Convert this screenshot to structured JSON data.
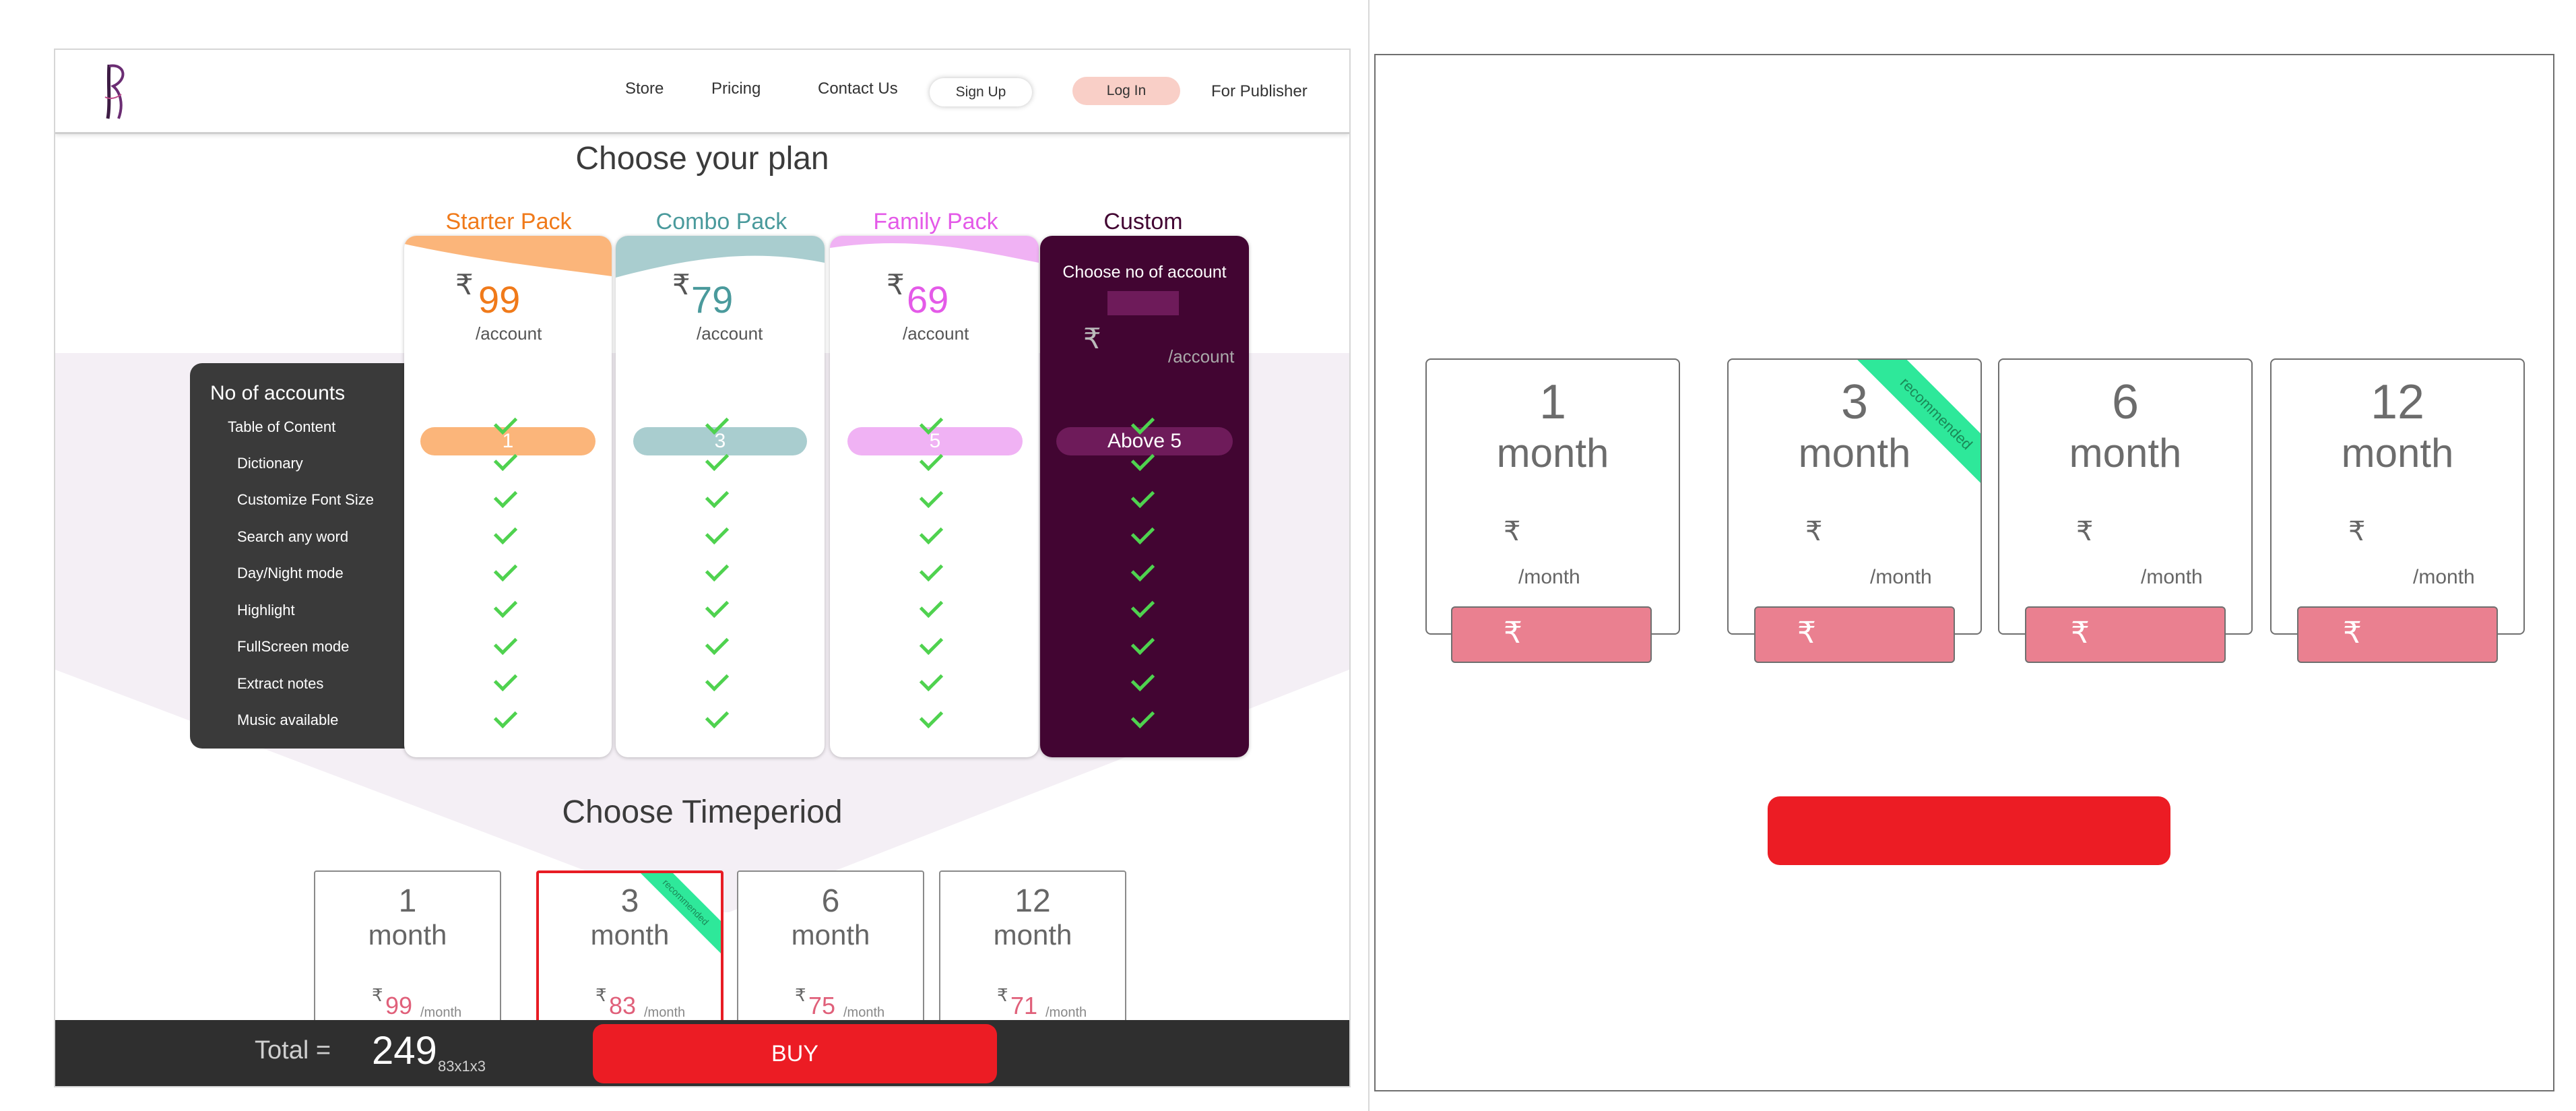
{
  "nav": {
    "logo_glyph": "R",
    "store": "Store",
    "pricing": "Pricing",
    "contact": "Contact Us",
    "signup": "Sign Up",
    "login": "Log In",
    "publisher": "For Publisher"
  },
  "plans": {
    "title": "Choose your plan",
    "currency": "₹",
    "per_account": "/account",
    "starter": {
      "name": "Starter Pack",
      "price": "99",
      "accounts": "1",
      "color": "#f07a1a",
      "tint": "#fbb57a"
    },
    "combo": {
      "name": "Combo Pack",
      "price": "79",
      "accounts": "3",
      "color": "#4a9a9c",
      "tint": "#a9cdcf"
    },
    "family": {
      "name": "Family Pack",
      "price": "69",
      "accounts": "5",
      "color": "#e45ae8",
      "tint": "#f0b2f4"
    },
    "custom": {
      "name": "Custom",
      "prompt": "Choose no of account",
      "accounts": "Above 5",
      "color": "#420532"
    }
  },
  "features": {
    "header": "No of accounts",
    "items": [
      "Table of Content",
      "Dictionary",
      "Customize Font Size",
      "Search any word",
      "Day/Night mode",
      "Highlight",
      "FullScreen mode",
      "Extract notes",
      "Music available"
    ]
  },
  "timeperiod": {
    "title": "Choose Timeperiod",
    "unit": "month",
    "per_month": "/month",
    "recommended": "recommended",
    "options": [
      {
        "months": "1",
        "price": "99"
      },
      {
        "months": "3",
        "price": "83"
      },
      {
        "months": "6",
        "price": "75"
      },
      {
        "months": "12",
        "price": "71"
      }
    ]
  },
  "total": {
    "label": "Total =",
    "value": "249",
    "formula": "83x1x3",
    "buy": "BUY"
  },
  "colors": {
    "buy_red": "#ec1c24",
    "recommended_green": "#2ee89a",
    "selected_border": "#e81c24"
  }
}
